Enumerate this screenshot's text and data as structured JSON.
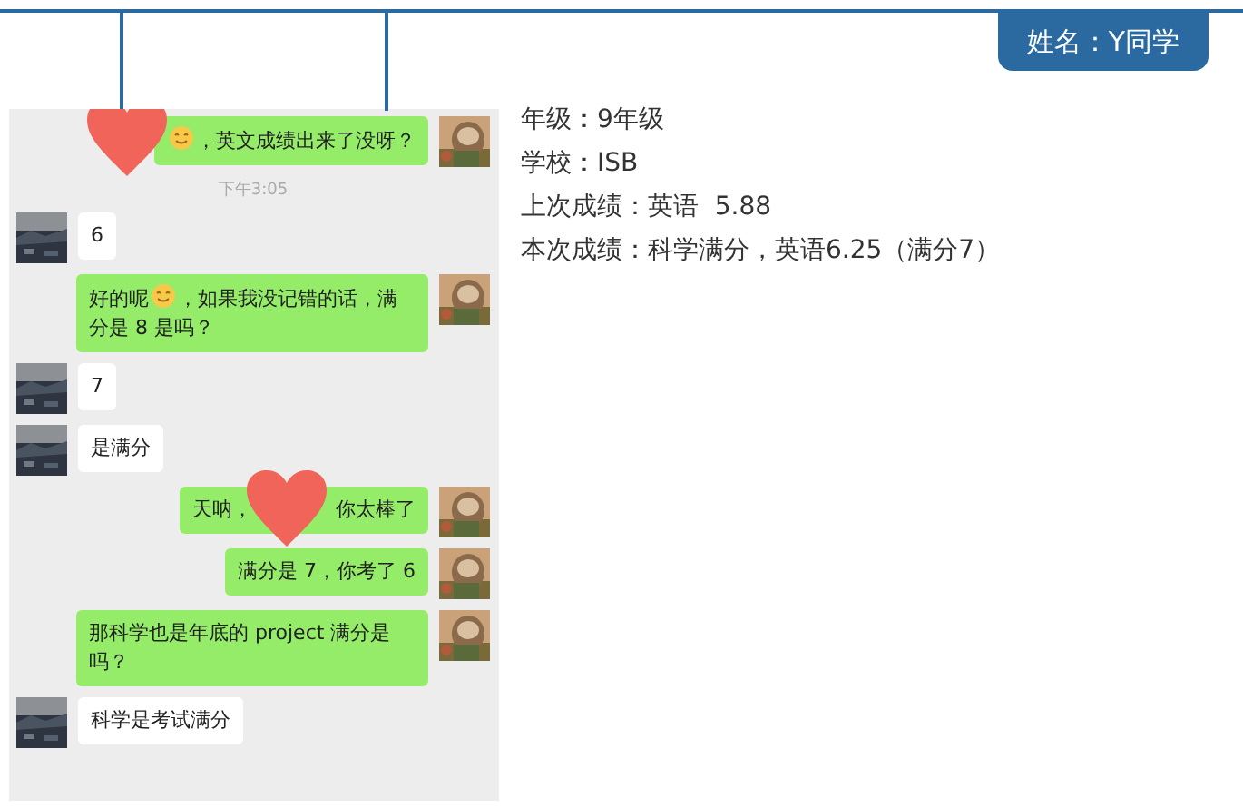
{
  "badge": "姓名：Y同学",
  "chat": [
    {
      "kind": "out",
      "sticker": true,
      "parts": [
        {
          "kind": "emoji"
        },
        {
          "kind": "text",
          "text": "，英文成绩出来了没呀？"
        }
      ]
    },
    {
      "kind": "time",
      "text": "下午3:05"
    },
    {
      "kind": "in",
      "parts": [
        {
          "kind": "text",
          "text": "6"
        }
      ]
    },
    {
      "kind": "out",
      "sticker": false,
      "parts": [
        {
          "kind": "text",
          "text": "好的呢"
        },
        {
          "kind": "emoji"
        },
        {
          "kind": "text",
          "text": "，如果我没记错的话，满分是 8 是吗？"
        }
      ]
    },
    {
      "kind": "in",
      "parts": [
        {
          "kind": "text",
          "text": "7"
        }
      ]
    },
    {
      "kind": "in",
      "parts": [
        {
          "kind": "text",
          "text": "是满分"
        }
      ]
    },
    {
      "kind": "out",
      "sticker": true,
      "parts": [
        {
          "kind": "text",
          "text": "天呐，"
        },
        {
          "kind": "gap"
        },
        {
          "kind": "text",
          "text": "你太棒了"
        }
      ]
    },
    {
      "kind": "out",
      "sticker": false,
      "parts": [
        {
          "kind": "text",
          "text": "满分是 7，你考了 6"
        }
      ]
    },
    {
      "kind": "out",
      "sticker": false,
      "parts": [
        {
          "kind": "text",
          "text": "那科学也是年底的 project 满分是吗？"
        }
      ]
    },
    {
      "kind": "in",
      "parts": [
        {
          "kind": "text",
          "text": "科学是考试满分"
        }
      ]
    }
  ],
  "info": [
    "年级：9年级",
    "学校：ISB",
    "上次成绩：英语  5.88",
    "本次成绩：科学满分，英语6.25（满分7）"
  ]
}
